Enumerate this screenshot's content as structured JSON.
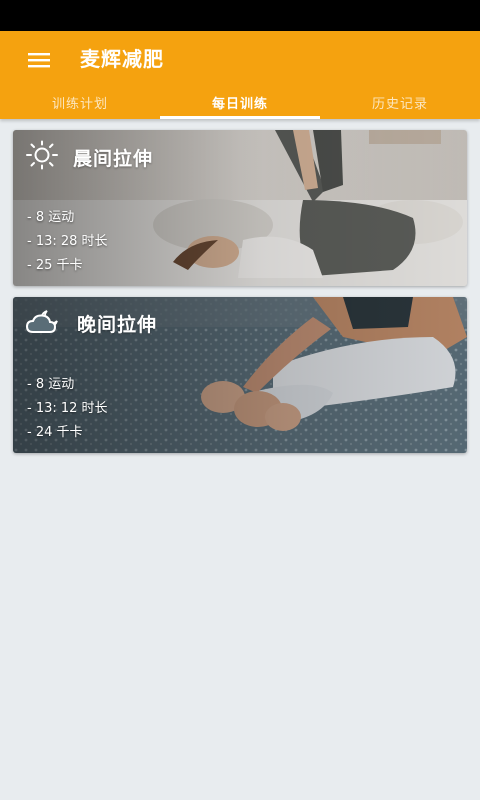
{
  "app": {
    "title": "麦辉减肥"
  },
  "tabs": [
    {
      "label": "训练计划",
      "active": false
    },
    {
      "label": "每日训练",
      "active": true
    },
    {
      "label": "历史记录",
      "active": false
    }
  ],
  "workouts": [
    {
      "title": "晨间拉伸",
      "icon": "sun-icon",
      "stats": [
        "- 8 运动",
        "- 13: 28 时长",
        "- 25 千卡"
      ]
    },
    {
      "title": "晚间拉伸",
      "icon": "cloud-moon-icon",
      "stats": [
        "- 8 运动",
        "- 13: 12 时长",
        "- 24 千卡"
      ]
    }
  ],
  "colors": {
    "accent": "#f5a20f",
    "background": "#e8ecef",
    "status_bar": "#000000"
  }
}
